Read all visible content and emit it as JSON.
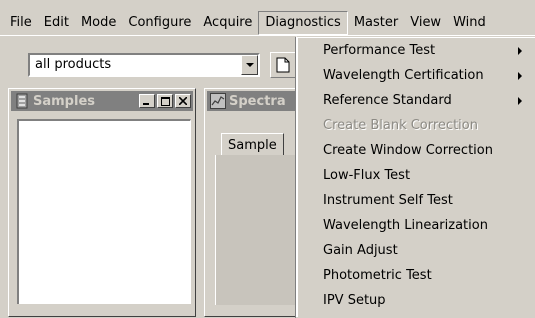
{
  "menubar": {
    "items": [
      "File",
      "Edit",
      "Mode",
      "Configure",
      "Acquire",
      "Diagnostics",
      "Master",
      "View",
      "Wind"
    ],
    "active_index": 5
  },
  "toolbar": {
    "product_combo_value": "all products"
  },
  "samples_window": {
    "title": "Samples"
  },
  "spectra_window": {
    "title": "Spectra",
    "tab_label": "Sample"
  },
  "diagnostics_menu": {
    "items": [
      {
        "label": "Performance Test",
        "submenu": true,
        "enabled": true
      },
      {
        "label": "Wavelength Certification",
        "submenu": true,
        "enabled": true
      },
      {
        "label": "Reference Standard",
        "submenu": true,
        "enabled": true
      },
      {
        "label": "Create Blank Correction",
        "submenu": false,
        "enabled": false
      },
      {
        "label": "Create Window Correction",
        "submenu": false,
        "enabled": true
      },
      {
        "label": "Low-Flux Test",
        "submenu": false,
        "enabled": true
      },
      {
        "label": "Instrument Self Test",
        "submenu": false,
        "enabled": true
      },
      {
        "label": "Wavelength Linearization",
        "submenu": false,
        "enabled": true
      },
      {
        "label": "Gain Adjust",
        "submenu": false,
        "enabled": true
      },
      {
        "label": "Photometric Test",
        "submenu": false,
        "enabled": true
      },
      {
        "label": "IPV Setup",
        "submenu": false,
        "enabled": true
      }
    ]
  },
  "colors": {
    "face": "#d4d0c8",
    "inactive_title": "#808080",
    "disabled_text": "#8c8a84"
  }
}
